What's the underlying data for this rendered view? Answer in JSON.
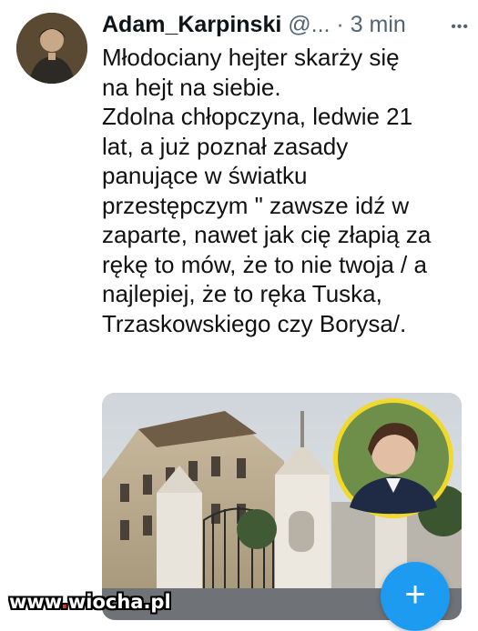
{
  "tweet": {
    "author_name": "Adam_Karpinski",
    "handle": "@...",
    "separator": "·",
    "time": "3 min",
    "more_icon": "more-icon",
    "text": "Młodociany hejter skarży się\nna hejt na siebie.\nZdolna chłopczyna, ledwie 21\nlat, a już poznał zasady\npanujące w światku\nprzestępczym \" zawsze idź w\nzaparte, nawet jak cię złapią za\nrękę to mów, że to nie twoja / a\nnajlepiej, że to ręka Tuska,\nTrzaskowskiego czy Borysa/."
  },
  "fab": {
    "label": "+",
    "color": "#1d9bf0"
  },
  "watermark": {
    "prefix": "www",
    "dot": ".",
    "site": "wiocha.pl"
  },
  "colors": {
    "secondary_text": "#536471",
    "primary_text": "#0f1419",
    "accent": "#1d9bf0"
  }
}
